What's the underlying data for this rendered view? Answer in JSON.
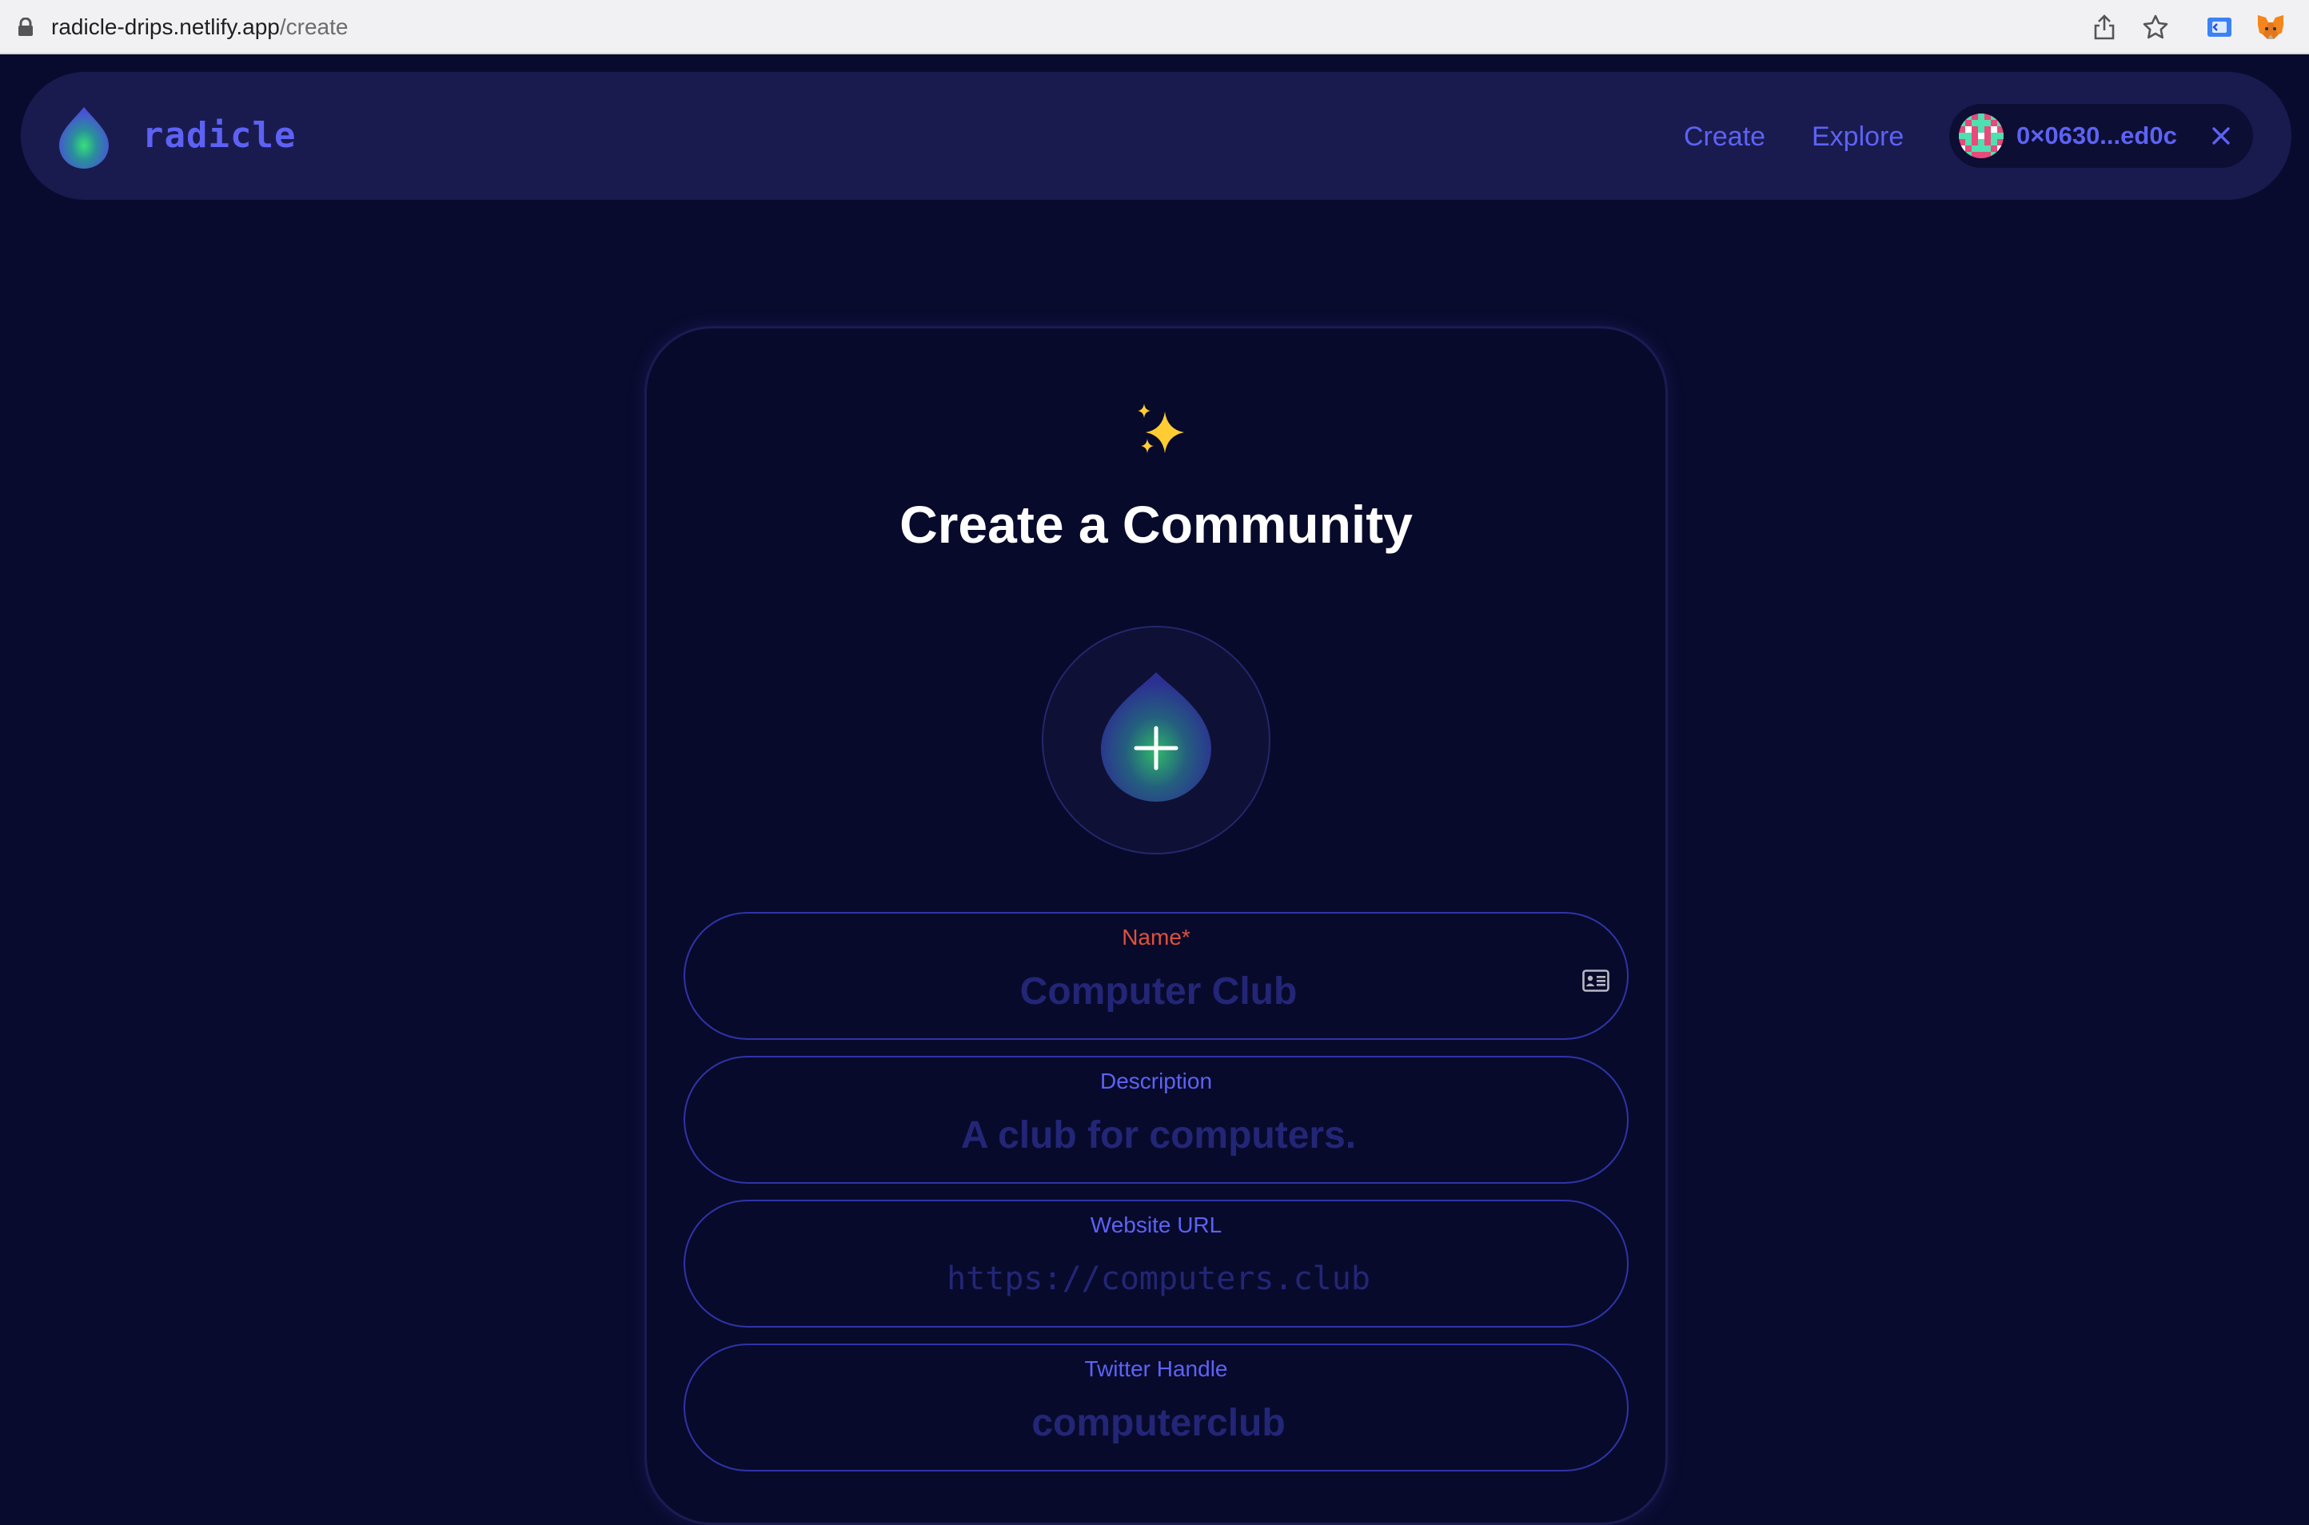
{
  "browser": {
    "url_host": "radicle-drips.netlify.app",
    "url_path": "/create"
  },
  "header": {
    "brand": "radicle",
    "nav": {
      "create": "Create",
      "explore": "Explore"
    },
    "wallet": {
      "address": "0×0630...ed0c"
    }
  },
  "page": {
    "title": "Create a Community"
  },
  "form": {
    "name": {
      "label": "Name*",
      "placeholder": "Computer Club",
      "value": ""
    },
    "description": {
      "label": "Description",
      "placeholder": "A club for computers.",
      "value": ""
    },
    "website": {
      "label": "Website URL",
      "placeholder": "https://computers.club",
      "value": ""
    },
    "twitter": {
      "label": "Twitter Handle",
      "placeholder": "computerclub",
      "value": ""
    }
  },
  "colors": {
    "background": "#090b2e",
    "header": "#191b4f",
    "accent": "#5d62f4",
    "required": "#e0513a",
    "placeholder": "#232676"
  },
  "icons": [
    "lock-icon",
    "share-icon",
    "star-icon",
    "extension-icon",
    "metamask-icon",
    "radicle-drop-icon",
    "close-icon",
    "sparkles-icon",
    "add-drop-icon",
    "contact-card-icon"
  ]
}
